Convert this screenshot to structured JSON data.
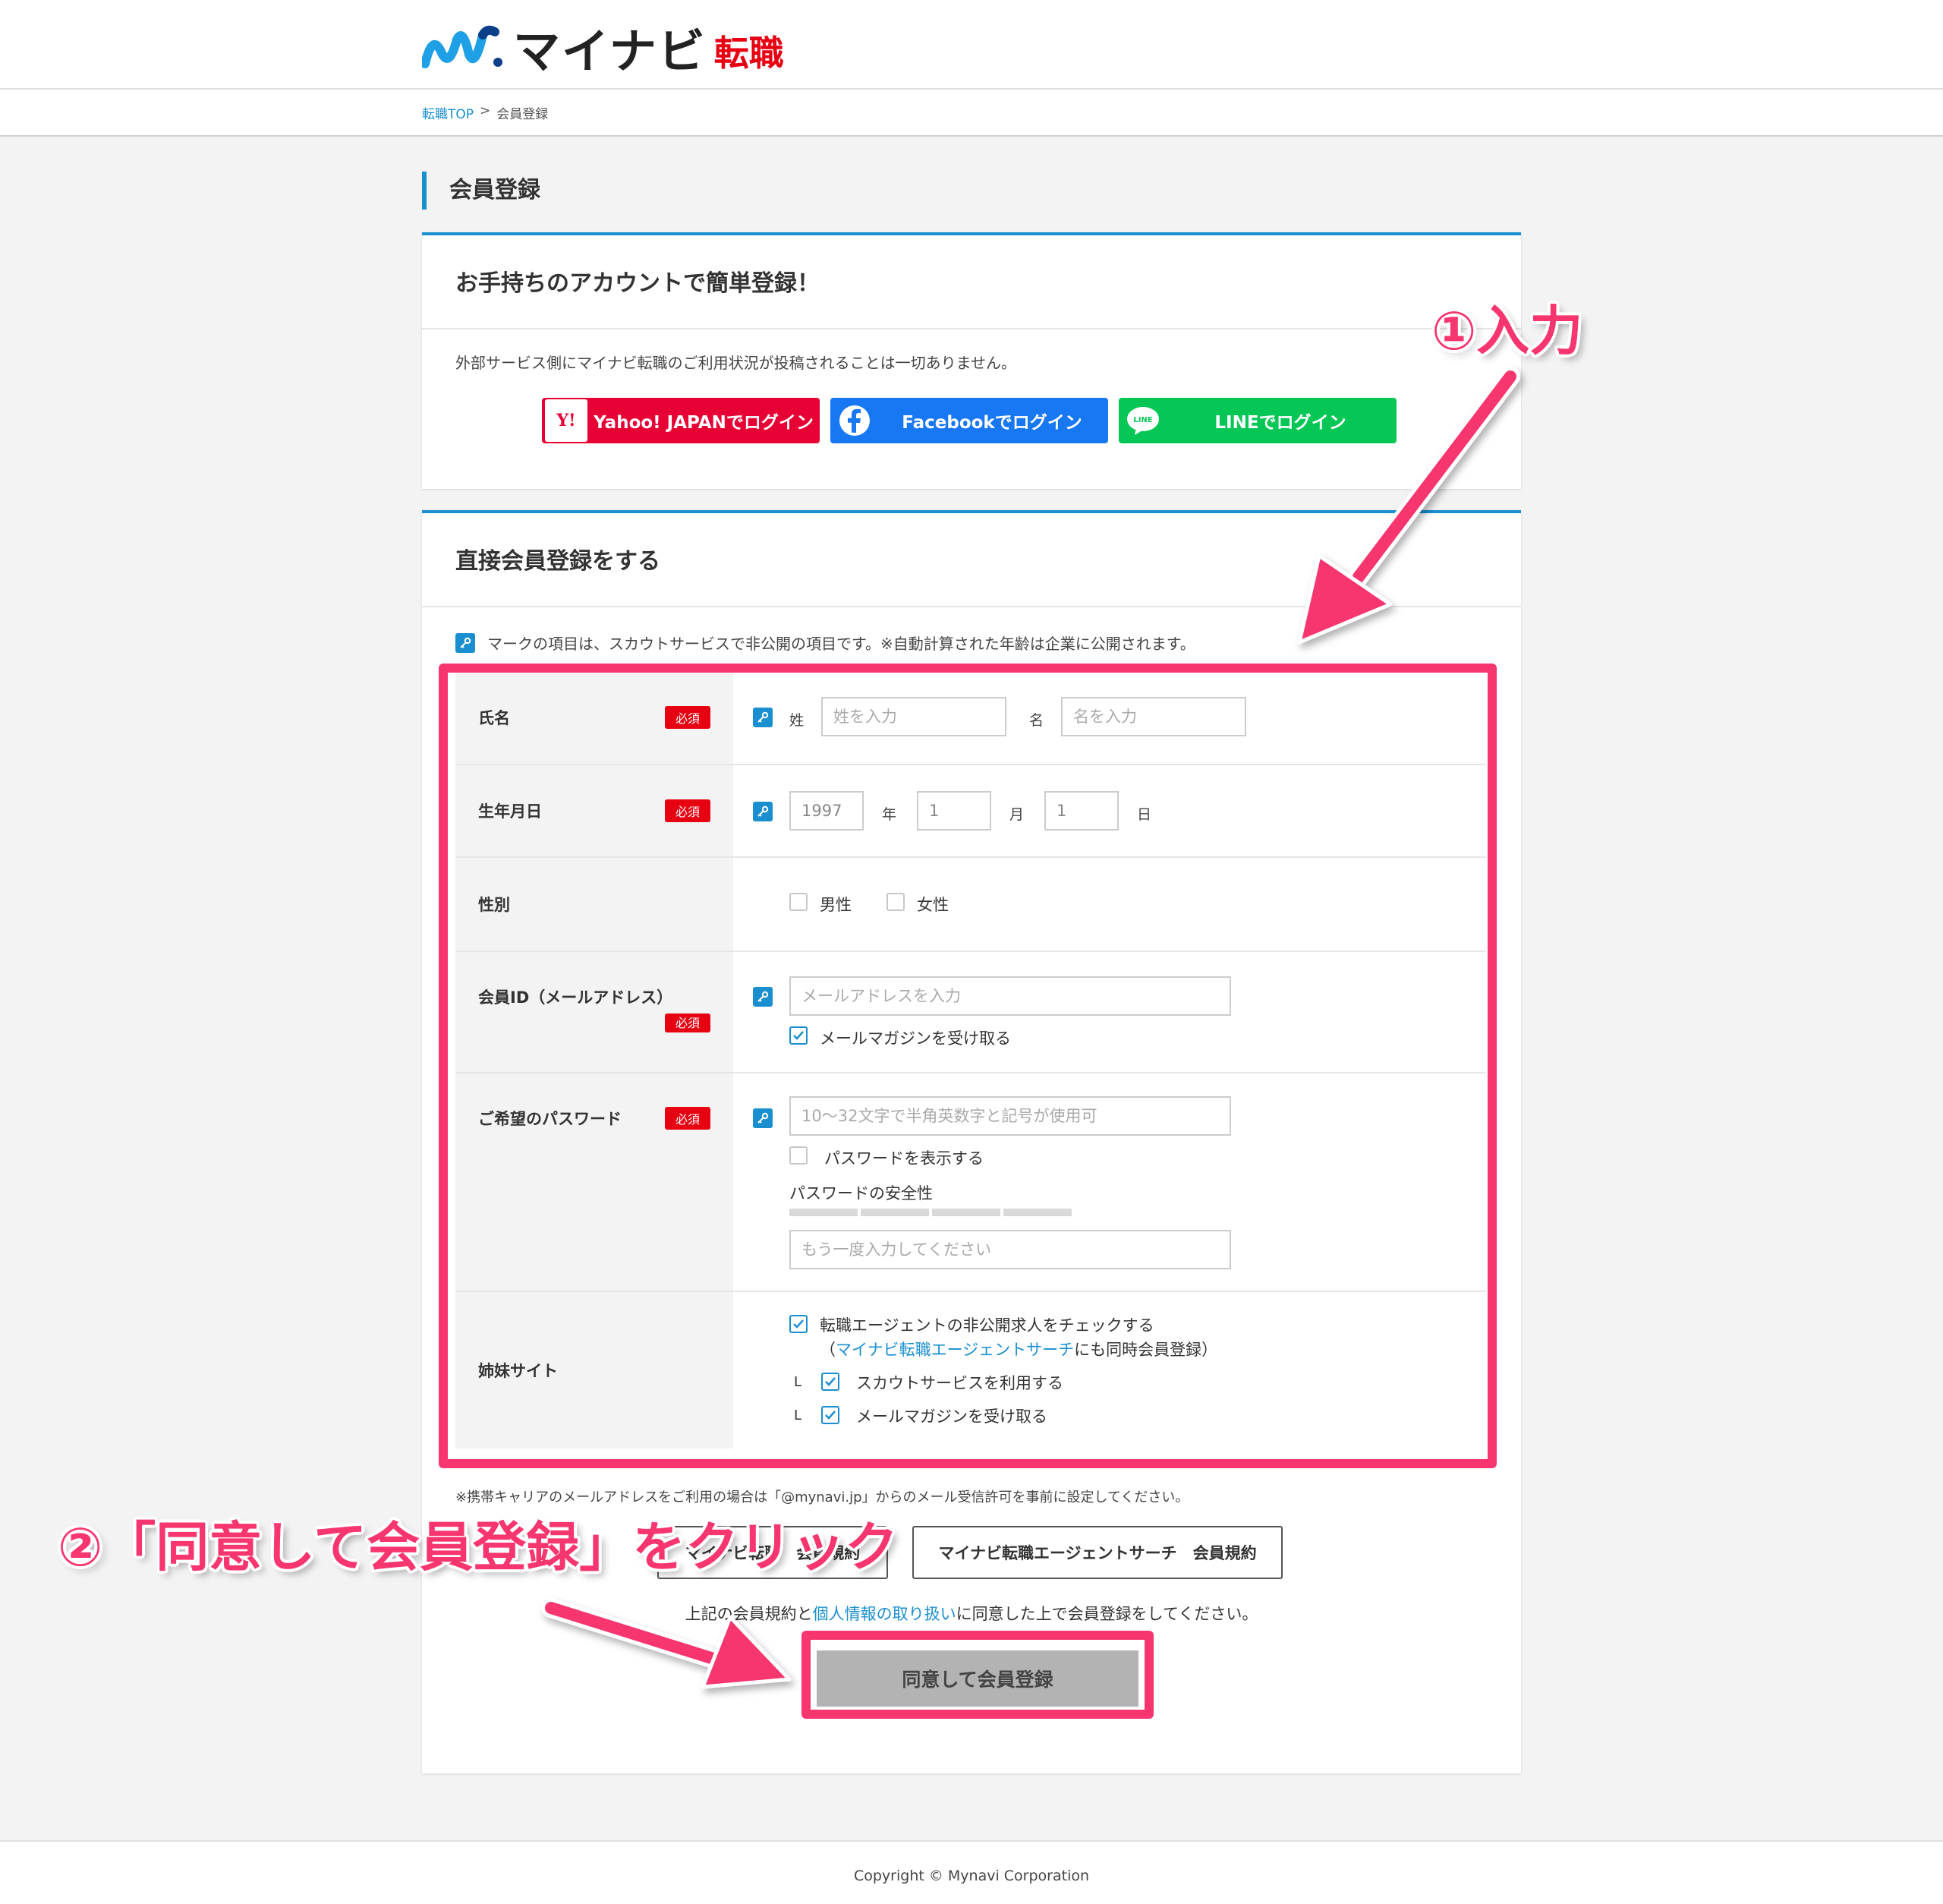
{
  "header": {
    "logo_text": "マイナビ",
    "logo_sub": "転職"
  },
  "breadcrumb": {
    "home": "転職TOP",
    "sep": ">",
    "current": "会員登録"
  },
  "page_title": "会員登録",
  "sns_card": {
    "title": "お手持ちのアカウントで簡単登録！",
    "note": "外部サービス側にマイナビ転職のご利用状況が投稿されることは一切ありません。",
    "yahoo_icon": "Y!",
    "yahoo_label": "Yahoo! JAPANでログイン",
    "facebook_label": "Facebookでログイン",
    "line_icon": "LINE",
    "line_label": "LINEでログイン"
  },
  "direct_card": {
    "title": "直接会員登録をする",
    "note": "マークの項目は、スカウトサービスで非公開の項目です。※自動計算された年齢は企業に公開されます。",
    "required_badge": "必須",
    "name": {
      "label": "氏名",
      "last_label": "姓",
      "last_placeholder": "姓を入力",
      "first_label": "名",
      "first_placeholder": "名を入力"
    },
    "birth": {
      "label": "生年月日",
      "year": "1997",
      "year_unit": "年",
      "month": "1",
      "month_unit": "月",
      "day": "1",
      "day_unit": "日"
    },
    "gender": {
      "label": "性別",
      "male": "男性",
      "female": "女性"
    },
    "member_id": {
      "label": "会員ID（メールアドレス）",
      "placeholder": "メールアドレスを入力",
      "newsletter": "メールマガジンを受け取る"
    },
    "password": {
      "label": "ご希望のパスワード",
      "placeholder": "10〜32文字で半角英数字と記号が使用可",
      "show": "パスワードを表示する",
      "strength_label": "パスワードの安全性",
      "strength_level": 0,
      "confirm_placeholder": "もう一度入力してください"
    },
    "sister": {
      "label": "姉妹サイト",
      "agent_check": "転職エージェントの非公開求人をチェックする",
      "paren_open": "（",
      "agent_link": "マイナビ転職エージェントサーチ",
      "paren_rest": "にも同時会員登録）",
      "sub_marker": "L",
      "scout": "スカウトサービスを利用する",
      "newsletter": "メールマガジンを受け取る"
    },
    "footnote": "※携帯キャリアのメールアドレスをご利用の場合は「@mynavi.jp」からのメール受信許可を事前に設定してください。",
    "terms_btn1": "マイナビ転職　会員規約",
    "terms_btn2": "マイナビ転職エージェントサーチ　会員規約",
    "agree_pre": "上記の会員規約と",
    "agree_link": "個人情報の取り扱い",
    "agree_post": "に同意した上で会員登録をしてください。",
    "submit": "同意して会員登録"
  },
  "footer": {
    "copyright": "Copyright © Mynavi Corporation"
  },
  "annotations": {
    "step1": "①入力",
    "step2": "②「同意して会員登録」をクリック",
    "color": "#f7356e"
  },
  "colors": {
    "accent": "#1a8fd0",
    "required": "#e60012",
    "yahoo": "#e60033",
    "facebook": "#1877f2",
    "line": "#06c755"
  }
}
